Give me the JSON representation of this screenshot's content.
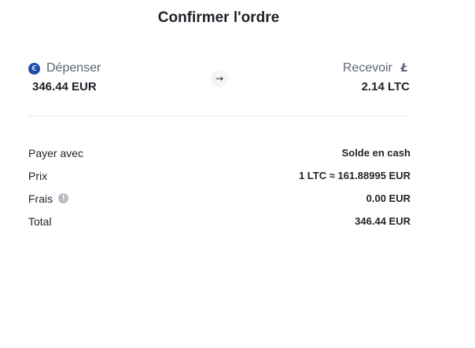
{
  "dialog": {
    "title": "Confirmer l'ordre"
  },
  "spend": {
    "label": "Dépenser",
    "amount": "346.44 EUR",
    "icon": "euro-coin-icon",
    "icon_glyph": "€",
    "icon_color": "#1f4fa8"
  },
  "receive": {
    "label": "Recevoir",
    "amount": "2.14 LTC",
    "icon": "litecoin-icon",
    "icon_glyph": "Ł"
  },
  "swap": {
    "icon": "arrow-right-icon",
    "glyph": "→"
  },
  "details": {
    "pay_with": {
      "label": "Payer avec",
      "value": "Solde en cash"
    },
    "price": {
      "label": "Prix",
      "value": "1 LTC ≈ 161.88995 EUR"
    },
    "fees": {
      "label": "Frais",
      "value": "0.00 EUR",
      "info_glyph": "!"
    },
    "total": {
      "label": "Total",
      "value": "346.44 EUR"
    }
  },
  "colors": {
    "text_primary": "#1e2329",
    "text_secondary": "#5e6673",
    "divider": "#eaecef",
    "info_icon": "#b7bdc6"
  }
}
